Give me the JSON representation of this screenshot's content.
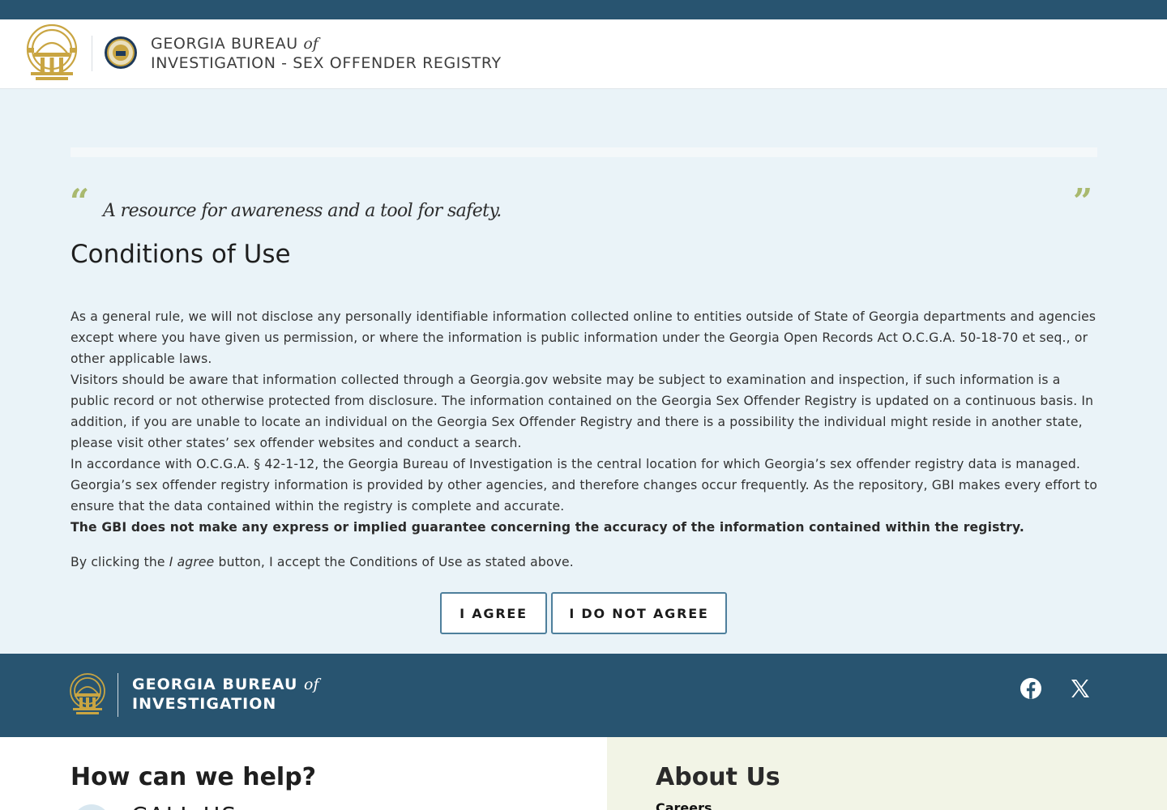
{
  "header": {
    "title_line1": "GEORGIA BUREAU",
    "title_of": "of",
    "title_line2": "INVESTIGATION - SEX OFFENDER REGISTRY"
  },
  "main": {
    "quote_open": "“",
    "quote_close": "”",
    "tagline": "A resource for awareness and a tool for safety.",
    "title": "Conditions of Use",
    "paragraphs": [
      "As a general rule, we will not disclose any personally identifiable information collected online to entities outside of State of Georgia departments and agencies except where you have given us permission, or where the information is public information under the Georgia Open Records Act O.C.G.A. 50-18-70 et seq., or other applicable laws.",
      "Visitors should be aware that information collected through a Georgia.gov website may be subject to examination and inspection, if such information is a public record or not otherwise protected from disclosure. The information contained on the Georgia Sex Offender Registry is updated on a continuous basis. In addition, if you are unable to locate an individual on the Georgia Sex Offender Registry and there is a possibility the individual might reside in another state, please visit other states’ sex offender websites and conduct a search.",
      "In accordance with O.C.G.A. § 42-1-12, the Georgia Bureau of Investigation is the central location for which Georgia’s sex offender registry data is managed. Georgia’s sex offender registry information is provided by other agencies, and therefore changes occur frequently. As the repository, GBI makes every effort to ensure that the data contained within the registry is complete and accurate."
    ],
    "disclaimer": "The GBI does not make any express or implied guarantee concerning the accuracy of the information contained within the registry.",
    "agree_prefix": "By clicking the ",
    "agree_em": "I agree",
    "agree_suffix": " button, I accept the Conditions of Use as stated above.",
    "agree_button": "I AGREE",
    "disagree_button": "I DO NOT AGREE"
  },
  "footer": {
    "title_line1": "GEORGIA BUREAU",
    "title_of": "of",
    "title_line2": "INVESTIGATION",
    "social": [
      "facebook-icon",
      "x-icon"
    ],
    "help_title": "How can we help?",
    "call_label": "CALL US",
    "about_title": "About Us",
    "about_link": "Careers"
  },
  "colors": {
    "brand_blue": "#285470",
    "page_bg": "#eaf3f8",
    "quote_green": "#a9b96f",
    "seal_gold": "#c9a542",
    "about_bg": "#f2f4e6"
  }
}
